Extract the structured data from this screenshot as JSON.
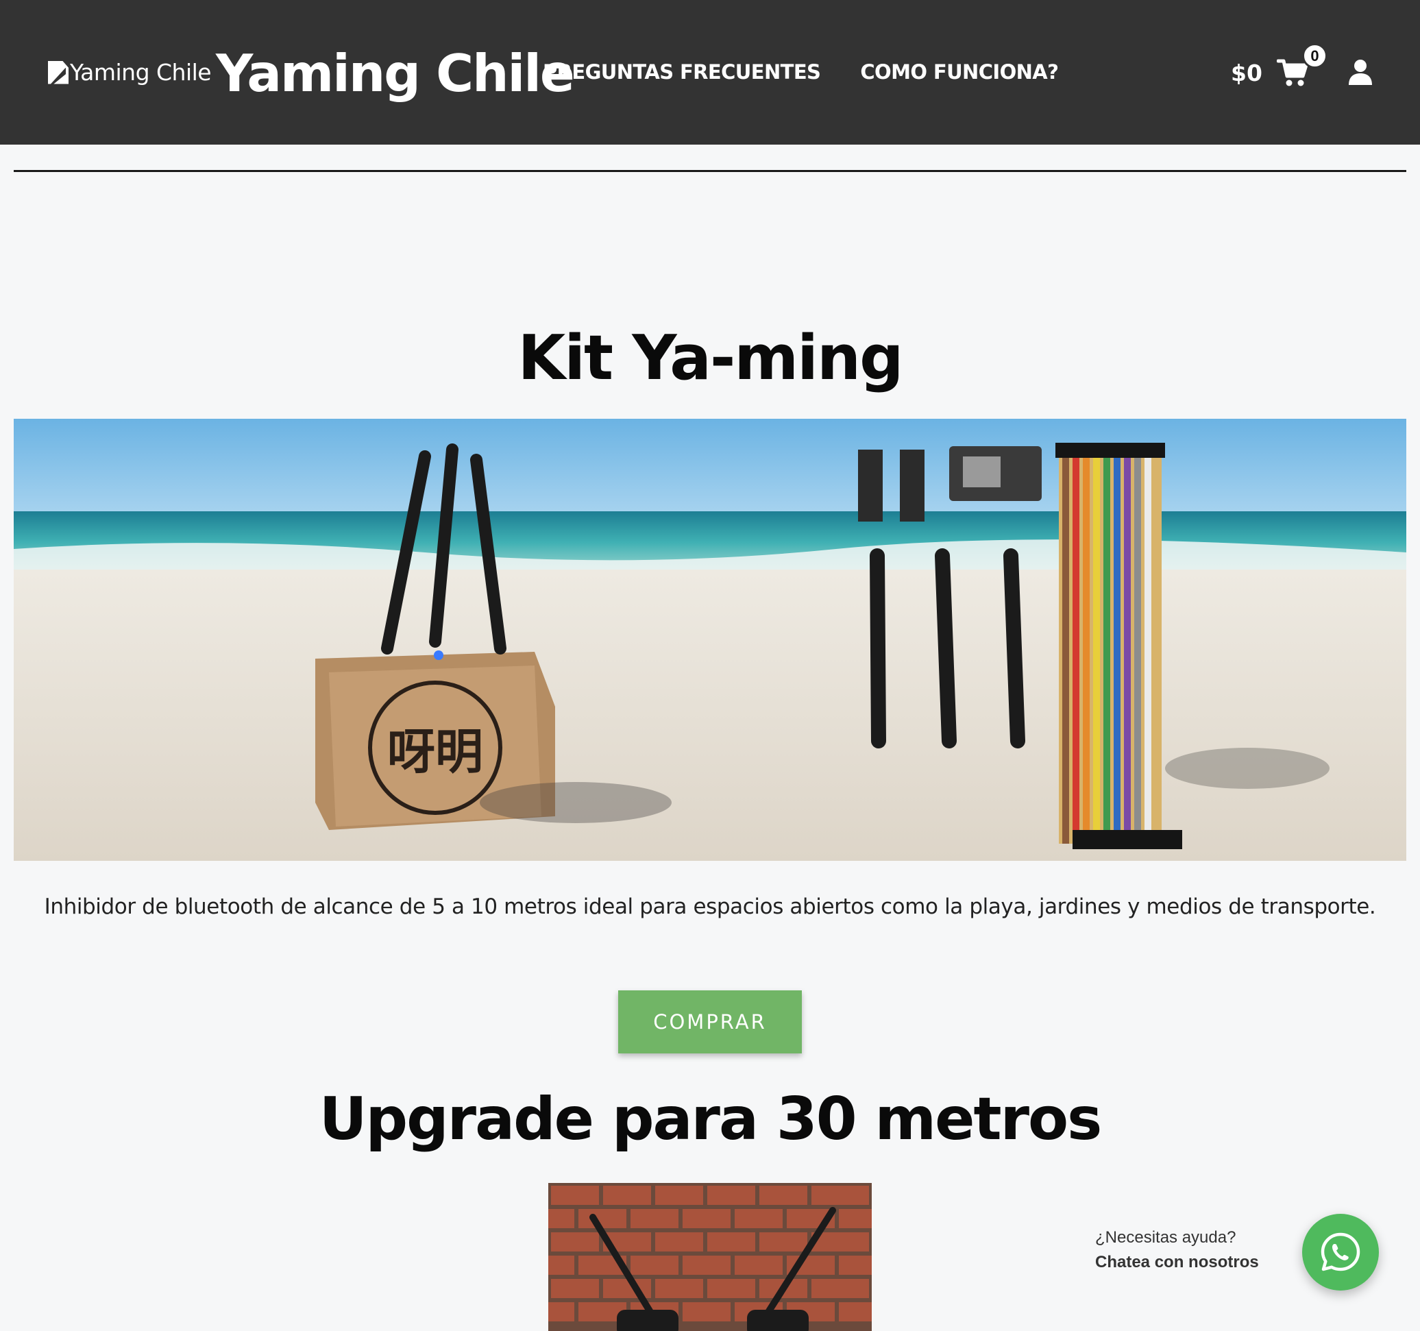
{
  "header": {
    "logo_alt": "Yaming Chile",
    "site_title": "Yaming Chile",
    "nav": [
      {
        "label": "PREGUNTAS FRECUENTES"
      },
      {
        "label": "COMO FUNCIONA?"
      }
    ],
    "cart_total": "$0",
    "cart_count": "0"
  },
  "main": {
    "kit_title": "Kit Ya-ming",
    "hero_image_alt": "Kit Ya-ming en la playa",
    "box_glyphs": "呀明",
    "description": "Inhibidor de bluetooth de alcance de 5 a 10 metros ideal para espacios abiertos como la playa, jardines y medios de transporte.",
    "buy_label": "COMPRAR",
    "upgrade_title": "Upgrade para 30 metros"
  },
  "chat": {
    "question": "¿Necesitas ayuda?",
    "cta": "Chatea con nosotros"
  },
  "colors": {
    "header_bg": "#333333",
    "accent_green": "#71b566",
    "whatsapp_green": "#4fba5d",
    "page_bg": "#f6f7f8"
  },
  "icons": [
    "broken-image-icon",
    "cart-icon",
    "user-icon",
    "whatsapp-icon"
  ]
}
